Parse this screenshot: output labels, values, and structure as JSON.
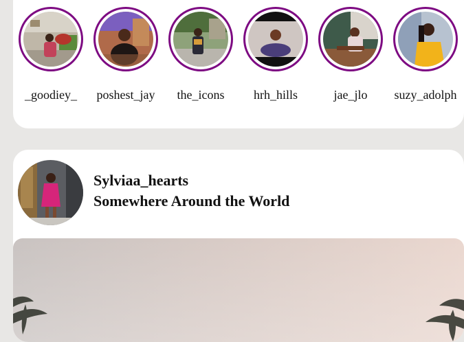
{
  "stories": [
    {
      "username": "_goodiey_",
      "icon": "profile-photo"
    },
    {
      "username": "poshest_jay",
      "icon": "profile-photo"
    },
    {
      "username": "the_icons",
      "icon": "profile-photo"
    },
    {
      "username": "hrh_hills",
      "icon": "profile-photo"
    },
    {
      "username": "jae_jlo",
      "icon": "profile-photo"
    },
    {
      "username": "suzy_adolph",
      "icon": "profile-photo"
    }
  ],
  "post": {
    "username": "Sylviaa_hearts",
    "location": "Somewhere Around the World"
  },
  "colors": {
    "story_ring": "#7d0a82",
    "page_background": "#e8e7e5",
    "card_background": "#ffffff"
  }
}
